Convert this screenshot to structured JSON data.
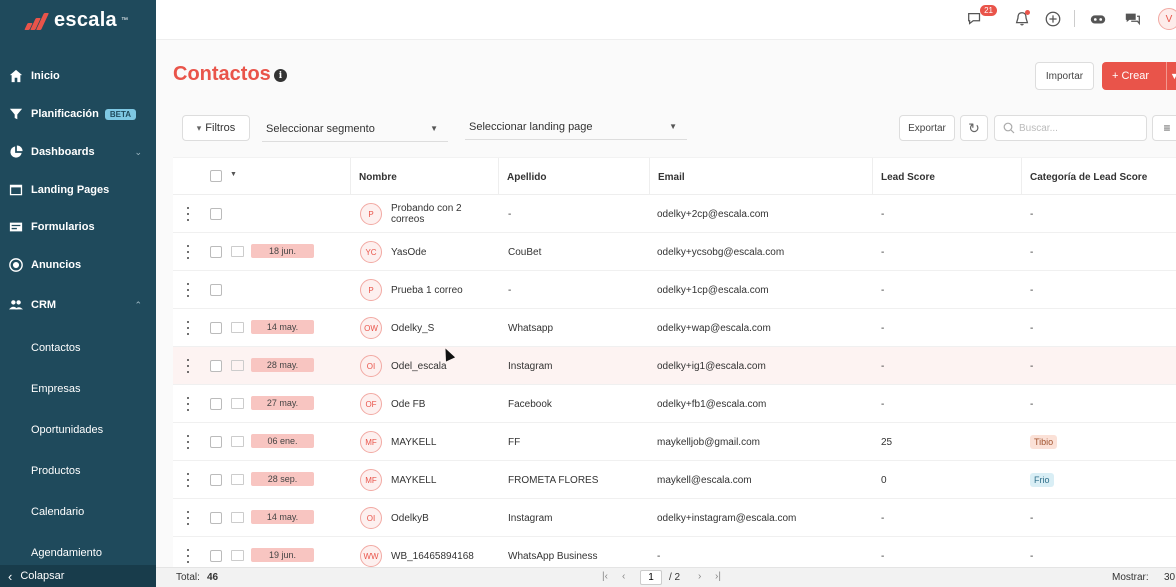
{
  "brand": {
    "name": "escala",
    "tm": "™",
    "color": "#e9544a"
  },
  "sidebar": {
    "items": [
      {
        "label": "Inicio",
        "icon": "home-icon"
      },
      {
        "label": "Planificación",
        "icon": "funnel-icon",
        "badge": "BETA"
      },
      {
        "label": "Dashboards",
        "icon": "pie-chart-icon"
      },
      {
        "label": "Landing Pages",
        "icon": "browser-icon"
      },
      {
        "label": "Formularios",
        "icon": "form-icon"
      },
      {
        "label": "Anuncios",
        "icon": "megaphone-icon"
      },
      {
        "label": "CRM",
        "icon": "users-icon"
      }
    ],
    "crm_sub": [
      "Contactos",
      "Empresas",
      "Oportunidades",
      "Productos",
      "Calendario",
      "Agendamiento"
    ],
    "collapse_label": "Colapsar"
  },
  "topbar": {
    "notifications_count": "21",
    "avatar_initial": "V"
  },
  "page": {
    "title": "Contactos",
    "info": "i",
    "import_label": "Importar",
    "create_label": "+ Crear",
    "filter_label": "Filtros",
    "segment_placeholder": "Seleccionar segmento",
    "landing_placeholder": "Seleccionar landing page",
    "export_label": "Exportar",
    "search_placeholder": "Buscar..."
  },
  "table": {
    "columns": [
      "Nombre",
      "Apellido",
      "Email",
      "Lead Score",
      "Categoría de Lead Score"
    ],
    "rows": [
      {
        "initials": "P",
        "date": "",
        "name": "Probando con 2 correos",
        "last": "-",
        "email": "odelky+2cp@escala.com",
        "score": "-",
        "category": "-"
      },
      {
        "initials": "YC",
        "date": "18 jun.",
        "name": "YasOde",
        "last": "CouBet",
        "email": "odelky+ycsobg@escala.com",
        "score": "-",
        "category": "-"
      },
      {
        "initials": "P",
        "date": "",
        "name": "Prueba 1 correo",
        "last": "-",
        "email": "odelky+1cp@escala.com",
        "score": "-",
        "category": "-"
      },
      {
        "initials": "OW",
        "date": "14 may.",
        "name": "Odelky_S",
        "last": "Whatsapp",
        "email": "odelky+wap@escala.com",
        "score": "-",
        "category": "-"
      },
      {
        "initials": "OI",
        "date": "28 may.",
        "name": "Odel_escala",
        "last": "Instagram",
        "email": "odelky+ig1@escala.com",
        "score": "-",
        "category": "-"
      },
      {
        "initials": "OF",
        "date": "27 may.",
        "name": "Ode FB",
        "last": "Facebook",
        "email": "odelky+fb1@escala.com",
        "score": "-",
        "category": "-"
      },
      {
        "initials": "MF",
        "date": "06 ene.",
        "name": "MAYKELL",
        "last": "FF",
        "email": "maykelljob@gmail.com",
        "score": "25",
        "category": "Tibio"
      },
      {
        "initials": "MF",
        "date": "28 sep.",
        "name": "MAYKELL",
        "last": "FROMETA FLORES",
        "email": "maykell@escala.com",
        "score": "0",
        "category": "Frio"
      },
      {
        "initials": "OI",
        "date": "14 may.",
        "name": "OdelkyB",
        "last": "Instagram",
        "email": "odelky+instagram@escala.com",
        "score": "-",
        "category": "-"
      },
      {
        "initials": "WW",
        "date": "19 jun.",
        "name": "WB_16465894168",
        "last": "WhatsApp Business",
        "email": "-",
        "score": "-",
        "category": "-"
      }
    ]
  },
  "footer": {
    "total_label": "Total:",
    "total_value": "46",
    "page_current": "1",
    "page_total": "/ 2",
    "show_label": "Mostrar:",
    "show_value": "30"
  }
}
